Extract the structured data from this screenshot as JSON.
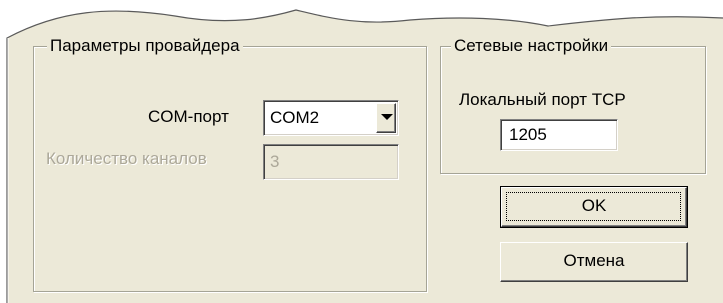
{
  "provider_params": {
    "title": "Параметры провайдера",
    "com_port_label": "COM-порт",
    "com_port_value": "COM2",
    "channels_label": "Количество каналов",
    "channels_value": "3"
  },
  "network_settings": {
    "title": "Сетевые настройки",
    "tcp_port_label": "Локальный порт TCP",
    "tcp_port_value": "1205"
  },
  "buttons": {
    "ok_label": "OK",
    "cancel_label": "Отмена"
  },
  "colors": {
    "dialog_background": "#ece9d8",
    "disabled_text": "#aca899",
    "frame_line": "#a5a496"
  }
}
